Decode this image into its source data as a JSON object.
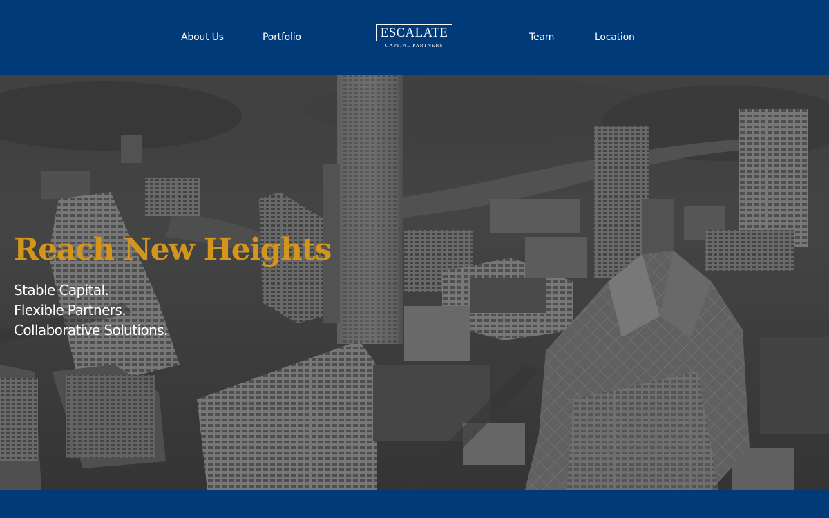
{
  "nav": {
    "about": "About Us",
    "portfolio": "Portfolio",
    "team": "Team",
    "location": "Location"
  },
  "logo": {
    "title": "ESCALATE",
    "subtitle": "CAPITAL PARTNERS"
  },
  "hero": {
    "headline": "Reach New Heights",
    "lines": [
      "Stable Capital.",
      "Flexible Partners.",
      "Collaborative Solutions."
    ]
  },
  "colors": {
    "brand_navy": "#003a78",
    "headline_gold": "#d4951c",
    "text_white": "#ffffff"
  }
}
